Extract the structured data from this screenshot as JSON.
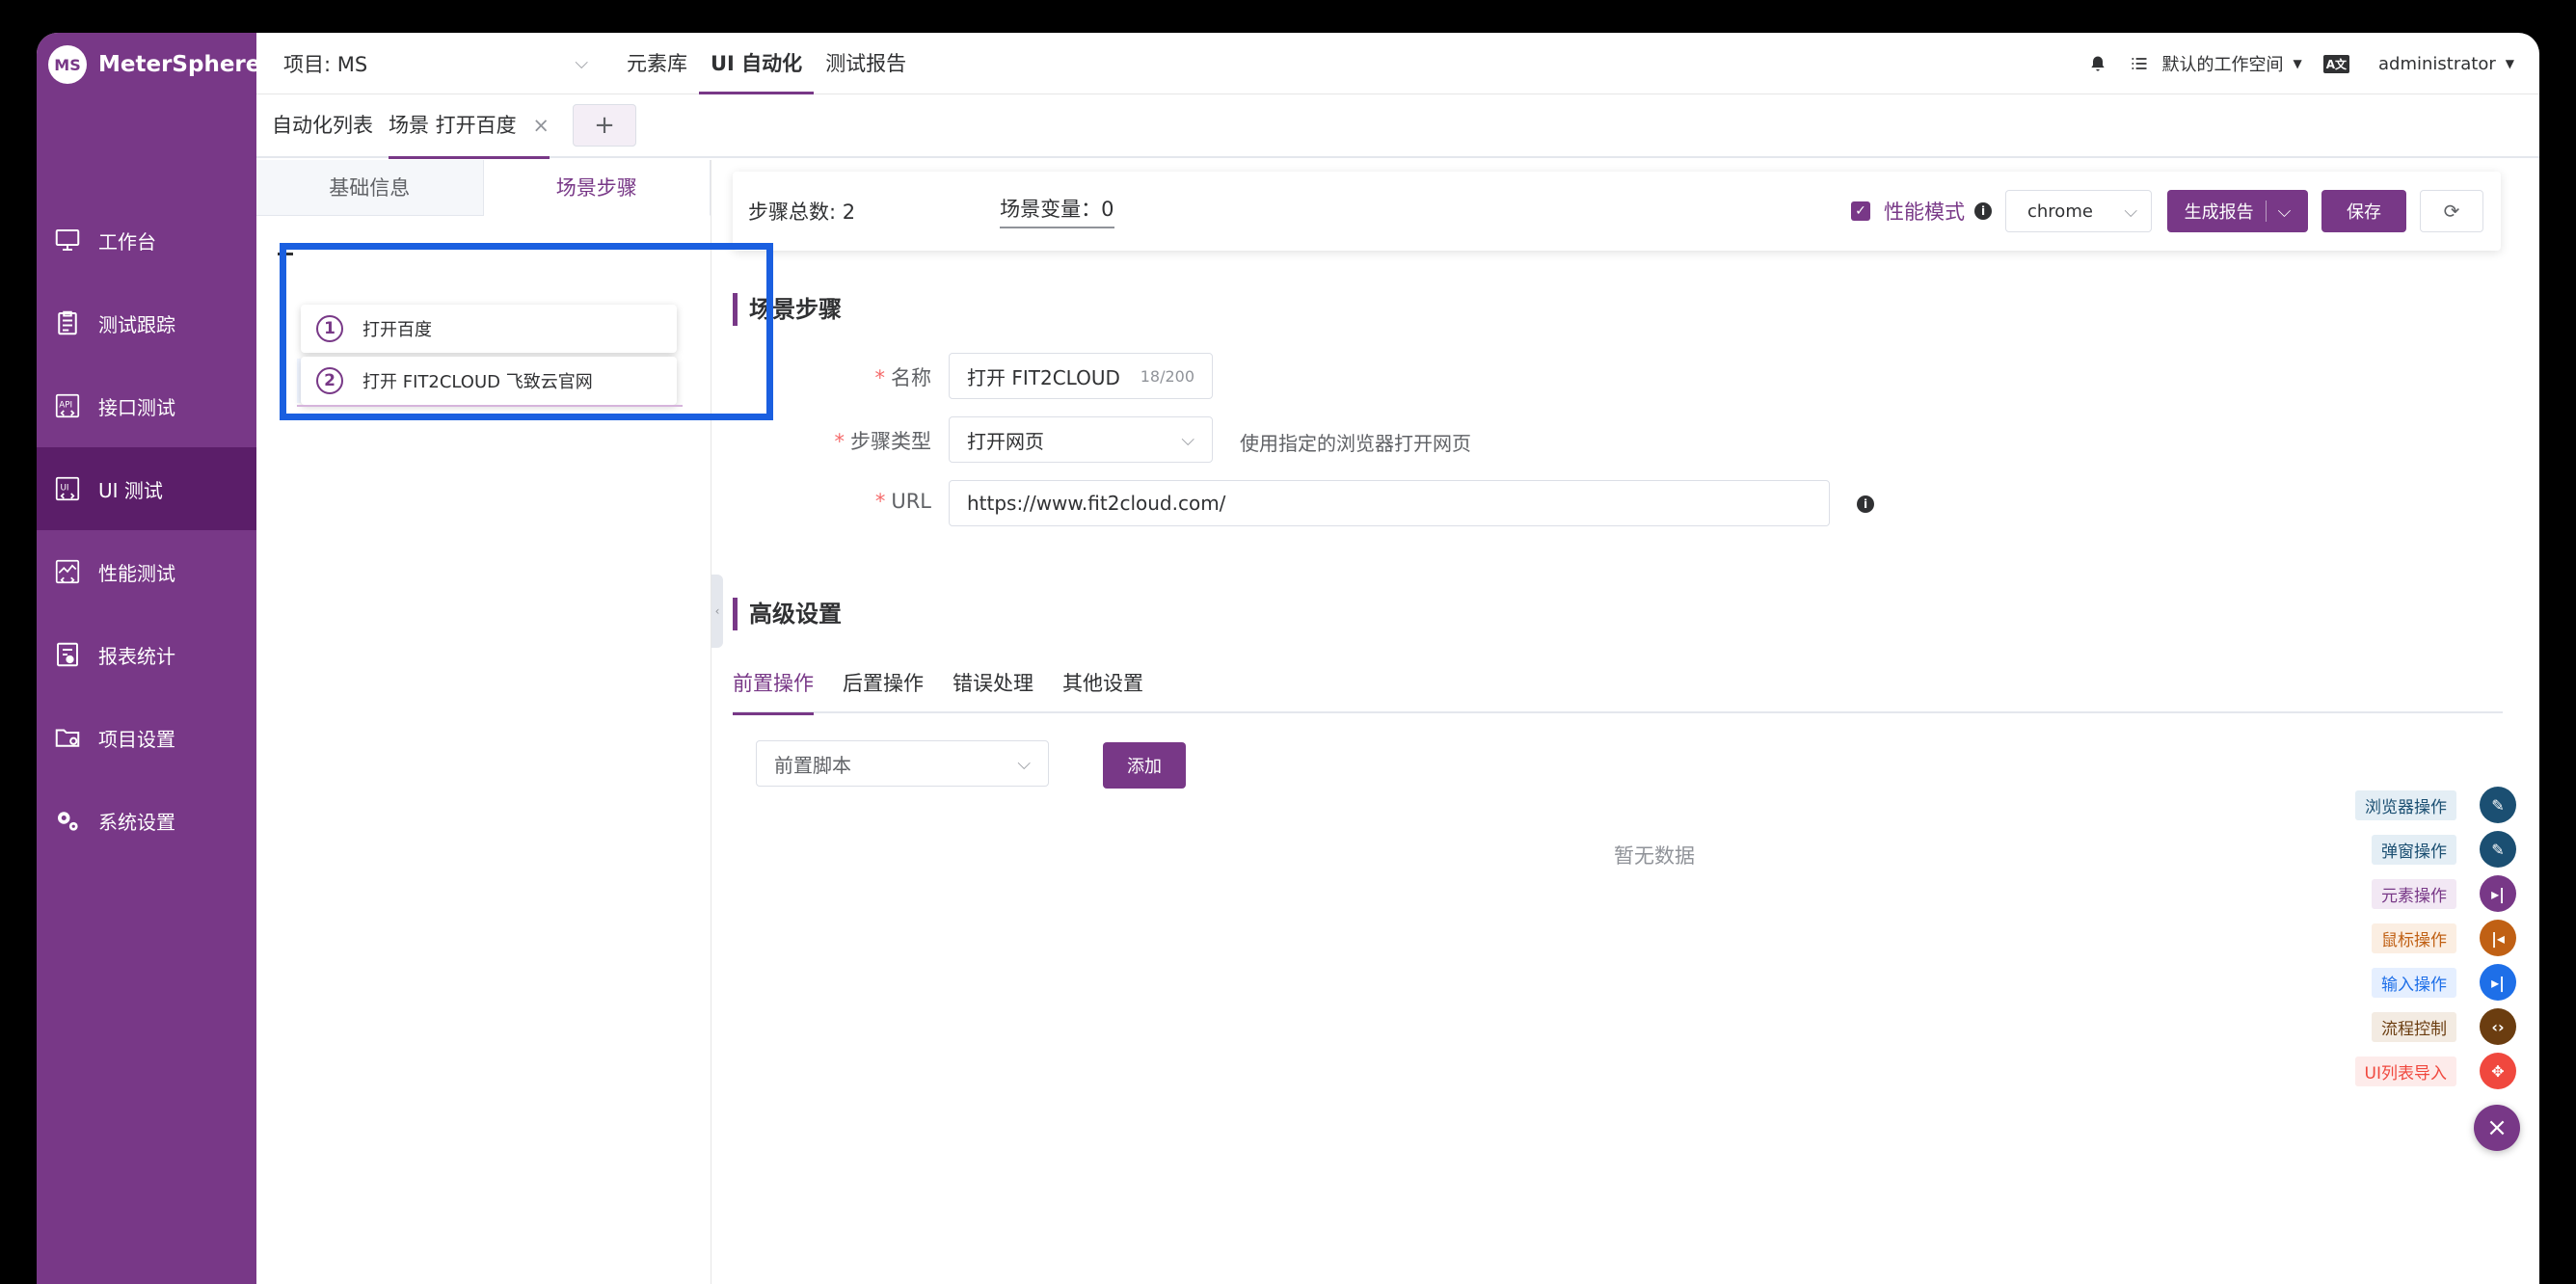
{
  "app": {
    "name": "MeterSphere",
    "logo_letters": "MS"
  },
  "header": {
    "project": "项目: MS",
    "nav": [
      "元素库",
      "UI 自动化",
      "测试报告"
    ],
    "workspace": "默认的工作空间",
    "lang_badge": "A文",
    "user": "administrator"
  },
  "sidebar": {
    "items": [
      {
        "label": "工作台",
        "icon": "monitor-icon"
      },
      {
        "label": "测试跟踪",
        "icon": "clipboard-icon"
      },
      {
        "label": "接口测试",
        "icon": "api-icon"
      },
      {
        "label": "UI 测试",
        "icon": "ui-icon"
      },
      {
        "label": "性能测试",
        "icon": "performance-chart-icon"
      },
      {
        "label": "报表统计",
        "icon": "report-icon"
      },
      {
        "label": "项目设置",
        "icon": "folder-settings-icon"
      },
      {
        "label": "系统设置",
        "icon": "gears-icon"
      }
    ]
  },
  "tabs": {
    "list": "自动化列表",
    "scene": "场景 打开百度",
    "close": "×",
    "add": "+"
  },
  "left_panel": {
    "tabs": [
      "基础信息",
      "场景步骤"
    ],
    "steps": [
      {
        "num": "1",
        "label": "打开百度"
      },
      {
        "num": "2",
        "label": "打开 FIT2CLOUD 飞致云官网"
      }
    ]
  },
  "toolbar": {
    "steps_total": "步骤总数: 2",
    "scene_vars": "场景变量：0",
    "perf_mode": "性能模式",
    "browser": "chrome",
    "report_btn": "生成报告",
    "save_btn": "保存"
  },
  "step_section": {
    "title": "场景步骤",
    "name_label": "名称",
    "name_value": "打开 FIT2CLOUD",
    "name_count": "18/200",
    "type_label": "步骤类型",
    "type_value": "打开网页",
    "type_hint": "使用指定的浏览器打开网页",
    "url_label": "URL",
    "url_value": "https://www.fit2cloud.com/"
  },
  "advanced": {
    "title": "高级设置",
    "tabs": [
      "前置操作",
      "后置操作",
      "错误处理",
      "其他设置"
    ],
    "select_value": "前置脚本",
    "add_btn": "添加",
    "empty": "暂无数据"
  },
  "fab": {
    "items": [
      {
        "label": "浏览器操作",
        "color": "#1b4f72",
        "bg": "#e4eef5",
        "fg": "#1b4f72"
      },
      {
        "label": "弹窗操作",
        "color": "#1b4f72",
        "bg": "#e4eef5",
        "fg": "#1b4f72"
      },
      {
        "label": "元素操作",
        "color": "#783887",
        "bg": "#f2e8f4",
        "fg": "#783887"
      },
      {
        "label": "鼠标操作",
        "color": "#c06014",
        "bg": "#fbeee2",
        "fg": "#c06014"
      },
      {
        "label": "输入操作",
        "color": "#1e6fe8",
        "bg": "#e5efff",
        "fg": "#1e6fe8"
      },
      {
        "label": "流程控制",
        "color": "#6b3d10",
        "bg": "#f3ebe2",
        "fg": "#6b3d10"
      },
      {
        "label": "UI列表导入",
        "color": "#f0483e",
        "bg": "#fdebea",
        "fg": "#f0483e"
      }
    ],
    "close": "×"
  },
  "colors": {
    "brand": "#783887",
    "brand_dark": "#5b1e69",
    "highlight_box": "#1a5fe0"
  }
}
